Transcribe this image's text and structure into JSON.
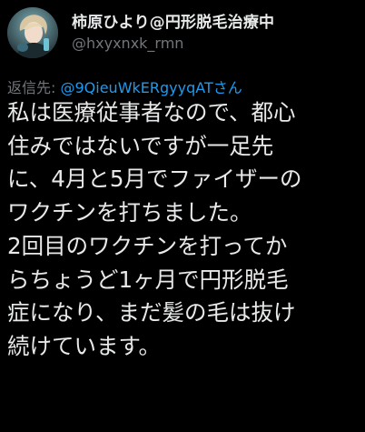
{
  "author": {
    "display_name": "柿原ひより@円形脱毛治療中",
    "handle": "@hxyxnxk_rmn",
    "avatar_icon": "avatar-photo"
  },
  "reply": {
    "prefix": "返信先: ",
    "target": "@9QieuWkERgyyqATさん"
  },
  "body": {
    "lines": [
      "私は医療従事者なので、都心",
      "住みではないですが一足先",
      "に、4月と5月でファイザーの",
      "ワクチンを打ちました。",
      "2回目のワクチンを打ってか",
      "らちょうど1ヶ月で円形脱毛",
      "症になり、まだ髪の毛は抜け",
      "続けています。"
    ]
  },
  "colors": {
    "background": "#000000",
    "primary_text": "#e7e9ea",
    "secondary_text": "#71767b",
    "link": "#1d9bf0"
  }
}
